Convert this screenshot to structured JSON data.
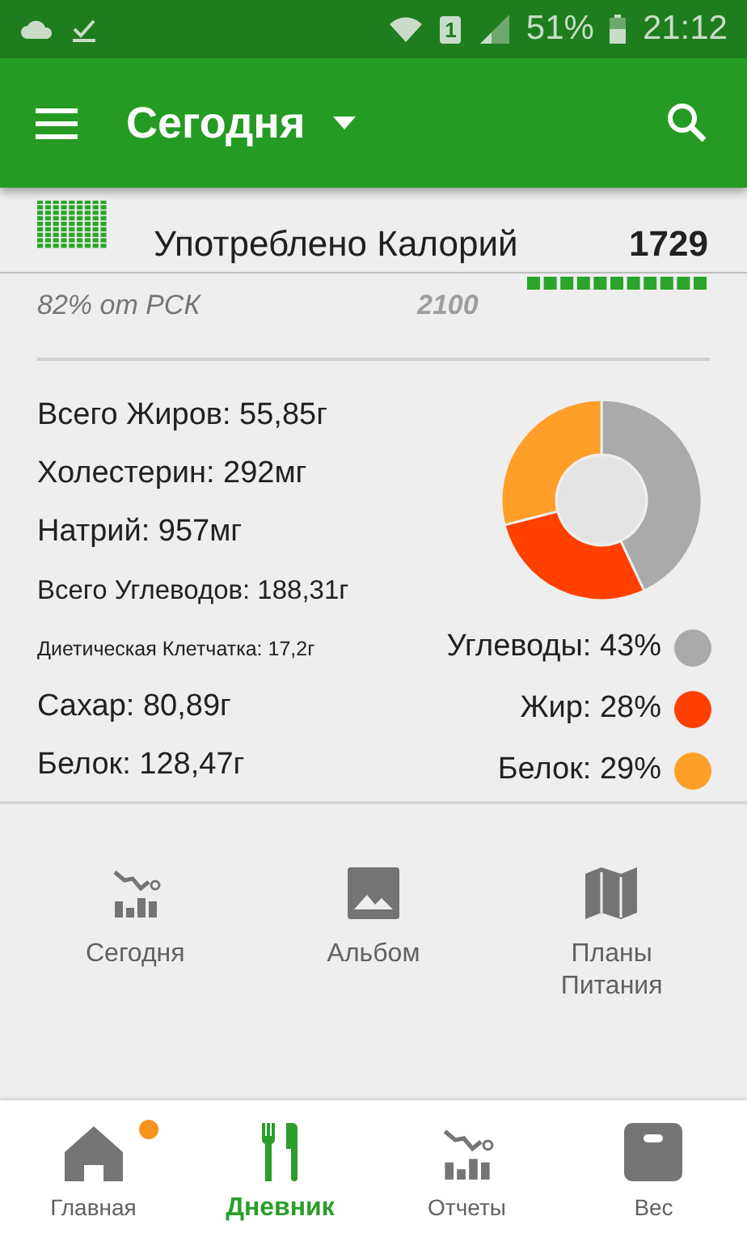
{
  "status_bar": {
    "battery": "51%",
    "time": "21:12",
    "sim": "1"
  },
  "app_bar": {
    "title": "Сегодня"
  },
  "calories": {
    "label": "Употреблено Калорий",
    "value": "1729",
    "percent_label": "82% от РСК",
    "goal": "2100"
  },
  "nutrients": [
    {
      "text": "Всего Жиров: 55,85г",
      "kind": "large"
    },
    {
      "text": "Холестерин: 292мг",
      "kind": "large"
    },
    {
      "text": "Натрий: 957мг",
      "kind": "large"
    },
    {
      "text": "Всего Углеводов: 188,31г",
      "kind": "medium"
    },
    {
      "text": "Диетическая Клетчатка: 17,2г",
      "kind": "small"
    },
    {
      "text": "Сахар: 80,89г",
      "kind": "large"
    },
    {
      "text": "Белок: 128,47г",
      "kind": "large"
    }
  ],
  "macro_chart": {
    "chart_data": {
      "type": "donut",
      "categories": [
        "Углеводы: 43%",
        "Жир: 28%",
        "Белок: 29%"
      ],
      "series": [
        {
          "values": [
            43,
            28,
            29
          ]
        }
      ]
    },
    "legend": [
      {
        "color": "#aaaaaa"
      },
      {
        "color": "#ff4000"
      },
      {
        "color": "#ff9f28"
      }
    ]
  },
  "shortcuts": [
    {
      "label": "Сегодня",
      "kind": "chart"
    },
    {
      "label": "Альбом",
      "kind": "image"
    },
    {
      "label": "Планы Питания",
      "kind": "map"
    }
  ],
  "bottom_nav": [
    {
      "label": "Главная",
      "kind": "home",
      "selected": false,
      "badge": true
    },
    {
      "label": "Дневник",
      "kind": "diary",
      "selected": true,
      "badge": false
    },
    {
      "label": "Отчеты",
      "kind": "chart",
      "selected": false,
      "badge": false
    },
    {
      "label": "Вес",
      "kind": "scale",
      "selected": false,
      "badge": false
    }
  ]
}
